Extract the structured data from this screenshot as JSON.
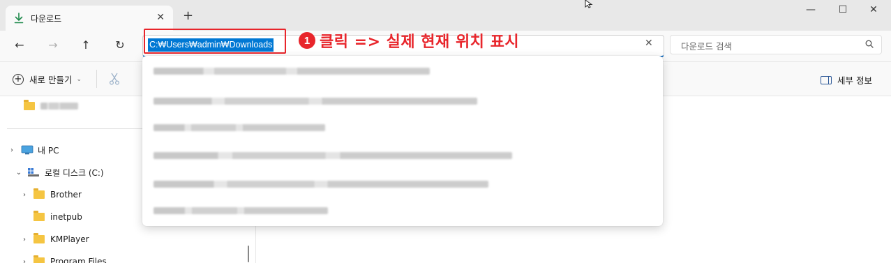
{
  "tab": {
    "title": "다운로드",
    "close": "✕",
    "new_tab": "+"
  },
  "window": {
    "minimize": "—",
    "maximize": "☐",
    "close": "✕"
  },
  "nav": {
    "back": "←",
    "forward": "→",
    "up": "↑",
    "refresh": "↻"
  },
  "address": {
    "path": "C:₩Users₩admin₩Downloads",
    "clear": "✕"
  },
  "annotation": {
    "number": "1",
    "text": "클릭 => 실제 현재 위치 표시"
  },
  "search": {
    "placeholder": "다운로드 검색"
  },
  "toolbar": {
    "new_label": "새로 만들기",
    "new_chevron": "⌄",
    "details_label": "세부 정보"
  },
  "sidebar": {
    "items": [
      {
        "label": "내 PC",
        "chevron": "›",
        "icon": "pc-icon"
      },
      {
        "label": "로컬 디스크 (C:)",
        "chevron": "⌄",
        "icon": "drive-icon"
      },
      {
        "label": "Brother",
        "chevron": "›",
        "icon": "folder-icon"
      },
      {
        "label": "inetpub",
        "chevron": "",
        "icon": "folder-icon"
      },
      {
        "label": "KMPlayer",
        "chevron": "›",
        "icon": "folder-icon"
      },
      {
        "label": "Program Files",
        "chevron": "›",
        "icon": "folder-icon"
      }
    ]
  },
  "colors": {
    "accent": "#005fb8",
    "annotation": "#e8252b",
    "selection": "#0078d4",
    "folder": "#f5c542"
  }
}
